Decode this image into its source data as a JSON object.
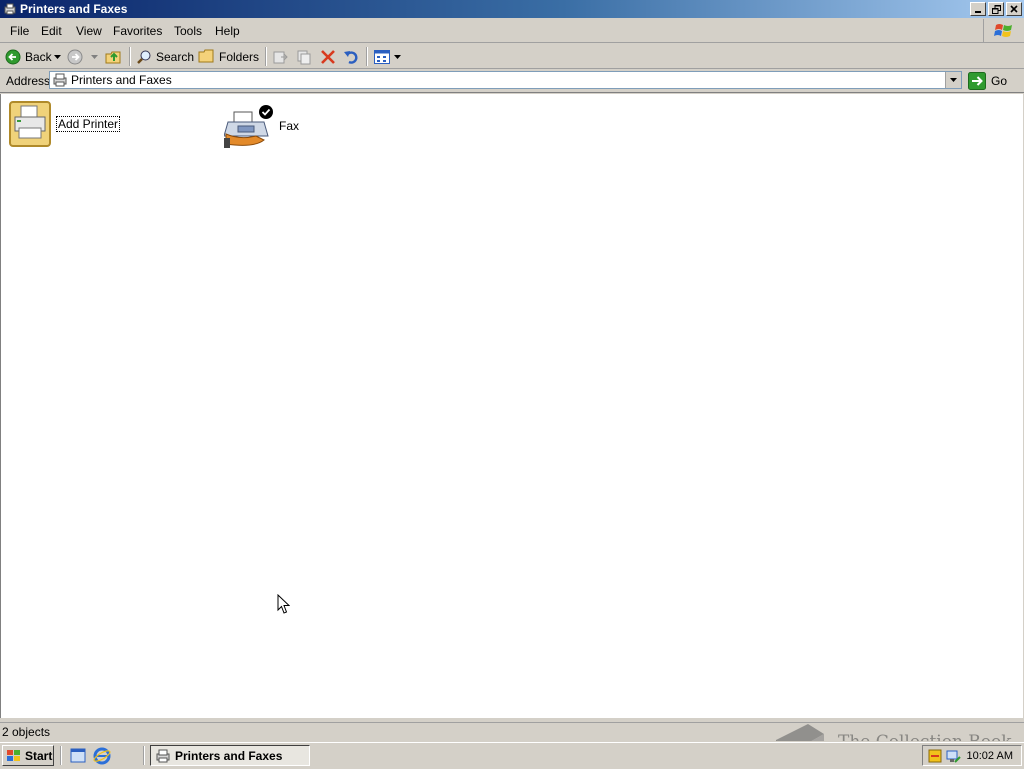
{
  "window": {
    "title": "Printers and Faxes",
    "controls": [
      "minimize-icon",
      "restore-icon",
      "close-icon"
    ]
  },
  "menu": [
    {
      "label": "File"
    },
    {
      "label": "Edit"
    },
    {
      "label": "View"
    },
    {
      "label": "Favorites"
    },
    {
      "label": "Tools"
    },
    {
      "label": "Help"
    }
  ],
  "toolbar": {
    "back_label": "Back",
    "search_label": "Search",
    "folders_label": "Folders"
  },
  "address": {
    "label": "Address",
    "value": "Printers and Faxes",
    "go_label": "Go"
  },
  "items": [
    {
      "label": "Add Printer",
      "icon": "add-printer-icon"
    },
    {
      "label": "Fax",
      "icon": "fax-icon"
    }
  ],
  "status": {
    "text": "2 objects"
  },
  "taskbar": {
    "start_label": "Start",
    "task_label": "Printers and Faxes",
    "clock": "10:02 AM"
  },
  "watermark": {
    "text": "The Collection Book"
  },
  "colors": {
    "title_gradient_start": "#0a246a",
    "title_gradient_end": "#a6caf0",
    "chrome": "#d4d0c8",
    "content_bg": "#ffffff"
  }
}
